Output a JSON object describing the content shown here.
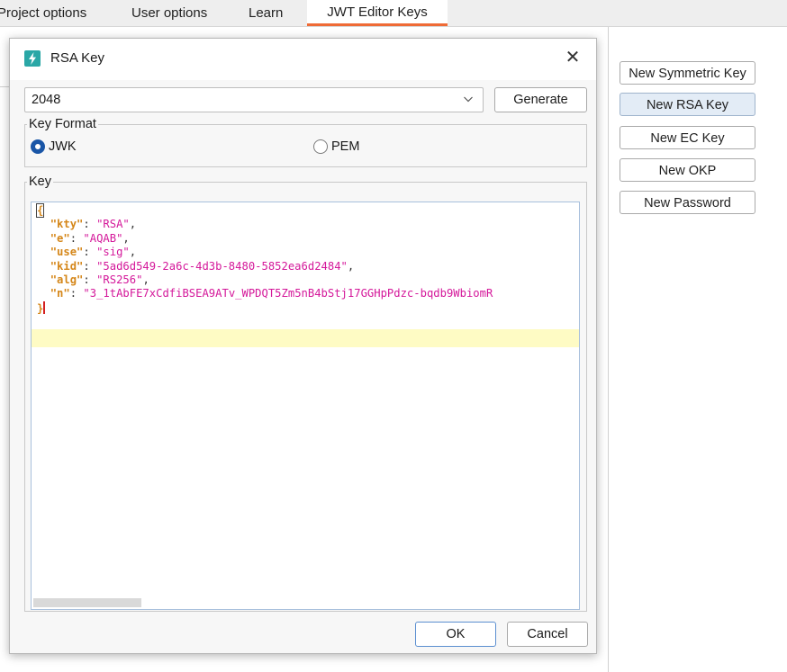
{
  "tabs": [
    {
      "label": "Project options"
    },
    {
      "label": "User options"
    },
    {
      "label": "Learn"
    },
    {
      "label": "JWT Editor Keys",
      "active": true
    }
  ],
  "side_buttons": {
    "symmetric": "New Symmetric Key",
    "rsa": "New RSA Key",
    "ec": "New EC Key",
    "okp": "New OKP",
    "password": "New Password"
  },
  "dialog": {
    "title": "RSA Key",
    "close_glyph": "✕",
    "key_size": {
      "value": "2048",
      "options": [
        "2048"
      ]
    },
    "generate_label": "Generate",
    "key_format": {
      "legend": "Key Format",
      "jwk_label": "JWK",
      "pem_label": "PEM",
      "selected": "JWK"
    },
    "key": {
      "legend": "Key",
      "open_brace": "{",
      "close_brace": "}",
      "fields": [
        {
          "key": "\"kty\"",
          "value": "\"RSA\"",
          "trail": ","
        },
        {
          "key": "\"e\"",
          "value": "\"AQAB\"",
          "trail": ","
        },
        {
          "key": "\"use\"",
          "value": "\"sig\"",
          "trail": ","
        },
        {
          "key": "\"kid\"",
          "value": "\"5ad6d549-2a6c-4d3b-8480-5852ea6d2484\"",
          "trail": ","
        },
        {
          "key": "\"alg\"",
          "value": "\"RS256\"",
          "trail": ","
        },
        {
          "key": "\"n\"",
          "value": "\"3_1tAbFE7xCdfiBSEA9ATv_WPDQT5Zm5nB4bStj17GGHpPdzc-bqdb9WbiomR",
          "trail": ""
        }
      ]
    },
    "ok_label": "OK",
    "cancel_label": "Cancel"
  },
  "colors": {
    "accent_tab": "#ef6b36",
    "json_key": "#d5871a",
    "json_string": "#d4189a",
    "current_line": "#fefbc4",
    "radio_checked": "#1a56a7",
    "app_icon": "#2aa7a6"
  },
  "icons": {
    "app": "lightning-bolt-icon",
    "close": "close-icon",
    "dropdown": "chevron-down-icon"
  }
}
